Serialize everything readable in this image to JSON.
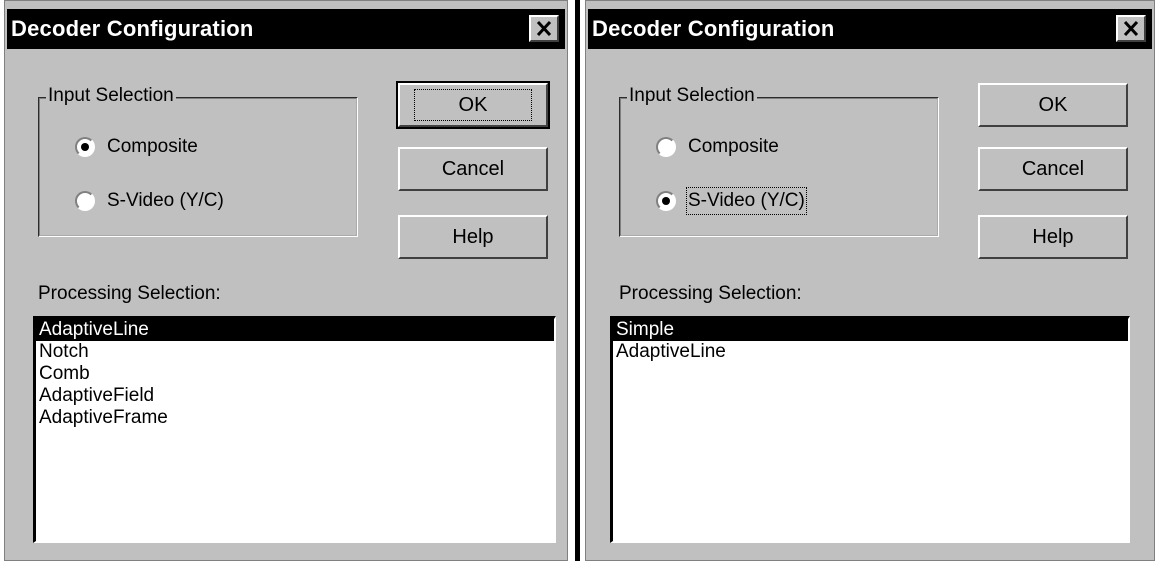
{
  "dialogs": [
    {
      "title": "Decoder Configuration",
      "input_selection": {
        "label": "Input Selection",
        "options": [
          {
            "label": "Composite",
            "selected": true
          },
          {
            "label": "S-Video (Y/C)",
            "selected": false
          }
        ]
      },
      "buttons": {
        "ok": "OK",
        "cancel": "Cancel",
        "help": "Help"
      },
      "processing_label": "Processing Selection:",
      "processing_items": [
        "AdaptiveLine",
        "Notch",
        "Comb",
        "AdaptiveField",
        "AdaptiveFrame"
      ],
      "selected_processing": "AdaptiveLine"
    },
    {
      "title": "Decoder Configuration",
      "input_selection": {
        "label": "Input Selection",
        "options": [
          {
            "label": "Composite",
            "selected": false
          },
          {
            "label": "S-Video (Y/C)",
            "selected": true
          }
        ]
      },
      "buttons": {
        "ok": "OK",
        "cancel": "Cancel",
        "help": "Help"
      },
      "processing_label": "Processing Selection:",
      "processing_items": [
        "Simple",
        "AdaptiveLine"
      ],
      "selected_processing": "Simple"
    }
  ],
  "colors": {
    "title_bg": "#000000",
    "dialog_bg": "#c0c0c0",
    "selection_bg": "#000000"
  }
}
